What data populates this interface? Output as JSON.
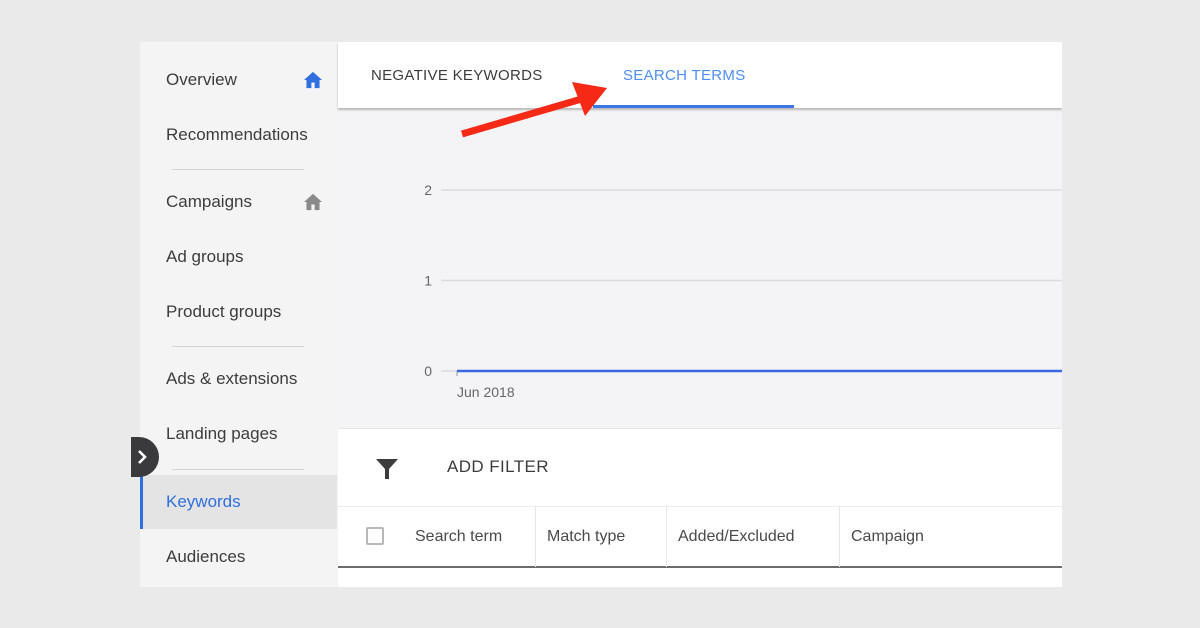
{
  "sidebar": {
    "items": [
      {
        "label": "Overview",
        "icon": "home-icon",
        "icon_color": "#2f6fe0"
      },
      {
        "label": "Recommendations"
      },
      {
        "label": "Campaigns",
        "icon": "home-icon",
        "icon_color": "#8a8a8a"
      },
      {
        "label": "Ad groups"
      },
      {
        "label": "Product groups"
      },
      {
        "label": "Ads & extensions"
      },
      {
        "label": "Landing pages"
      },
      {
        "label": "Keywords",
        "active": true
      },
      {
        "label": "Audiences"
      }
    ],
    "expand_icon": "chevron-right-icon"
  },
  "tabs": {
    "items": [
      {
        "label": "NEGATIVE KEYWORDS"
      },
      {
        "label": "SEARCH TERMS",
        "active": true
      }
    ]
  },
  "chart_data": {
    "type": "line",
    "title": "",
    "xlabel": "",
    "ylabel": "",
    "x": [
      "Jun 2018"
    ],
    "x_tick_labels": [
      "Jun 2018"
    ],
    "y_ticks": [
      0,
      1,
      2
    ],
    "ylim": [
      0,
      2
    ],
    "grid": true,
    "series": [
      {
        "name": "Search terms",
        "values": [
          0
        ],
        "color": "#3b68e0"
      }
    ]
  },
  "filter": {
    "icon": "filter-icon",
    "label": "ADD FILTER"
  },
  "table": {
    "columns": [
      "Search term",
      "Match type",
      "Added/Excluded",
      "Campaign"
    ]
  },
  "annotation": {
    "arrow_color": "#f42a16",
    "points_to": "SEARCH TERMS"
  },
  "colors": {
    "accent": "#3b78e7",
    "background": "#ebeaeb"
  }
}
